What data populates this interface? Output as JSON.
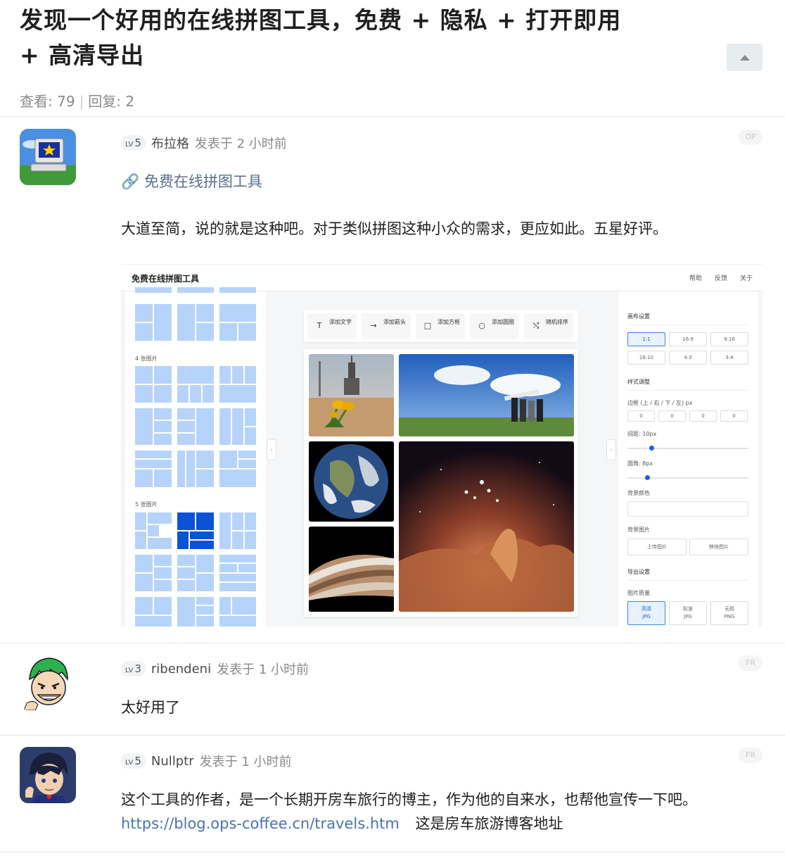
{
  "thread": {
    "title": "发现一个好用的在线拼图工具，免费 + 隐私 + 打开即用 + 高清导出",
    "views_label": "查看: 79",
    "replies_label": "回复: 2",
    "separator": "|"
  },
  "posts": [
    {
      "lv_prefix": "LV",
      "lv": "5",
      "author": "布拉格",
      "time": "发表于 2 小时前",
      "badge": "OP",
      "link_text": "🔗 免费在线拼图工具",
      "body": "大道至简，说的就是这种吧。对于类似拼图这种小众的需求，更应如此。五星好评。"
    },
    {
      "lv_prefix": "LV",
      "lv": "3",
      "author": "ribendeni",
      "time": "发表于 1 小时前",
      "badge": "FR",
      "body": "太好用了"
    },
    {
      "lv_prefix": "LV",
      "lv": "5",
      "author": "Nullptr",
      "time": "发表于 1 小时前",
      "badge": "FR",
      "body": "这个工具的作者，是一个长期开房车旅行的博主，作为他的自来水，也帮他宣传一下吧。",
      "url": "https://blog.ops-coffee.cn/travels.htm",
      "url_note": "这是房车旅游博客地址"
    }
  ],
  "screenshot": {
    "title": "免费在线拼图工具",
    "nav": [
      "帮助",
      "反馈",
      "关于"
    ],
    "group_4": "4 张图片",
    "group_5": "5 张图片",
    "tools": [
      {
        "icon": "T",
        "label": "添加文字"
      },
      {
        "icon": "→",
        "label": "添加箭头"
      },
      {
        "icon": "□",
        "label": "添加方框"
      },
      {
        "icon": "○",
        "label": "添加圆圈"
      },
      {
        "icon": "⤭",
        "label": "随机排序"
      }
    ],
    "canvas_settings": "画布设置",
    "ratios": [
      "1:1",
      "16:9",
      "9:16",
      "16:10",
      "4:3",
      "3:4"
    ],
    "style_adjust": "样式调整",
    "border_label": "边框 (上 / 右 / 下 / 左) px",
    "border_values": [
      "0",
      "0",
      "0",
      "0"
    ],
    "gap_label": "间距: 10px",
    "gap_value": 10,
    "radius_label": "圆角: 8px",
    "radius_value": 8,
    "bg_color": "背景颜色",
    "bg_image": "背景图片",
    "upload": "上传图片",
    "remove": "移除图片",
    "export_settings": "导出设置",
    "quality": "图片质量",
    "qualities": [
      {
        "name": "高清",
        "fmt": "JPG"
      },
      {
        "name": "标准",
        "fmt": "JPG"
      },
      {
        "name": "无损",
        "fmt": "PNG"
      }
    ],
    "collapse_glyph": "‹"
  },
  "colors": {
    "accent": "#1d5fd6",
    "template_fill": "#b6d3fb",
    "template_selected": "#0b53d6",
    "link": "#4a72b8"
  }
}
